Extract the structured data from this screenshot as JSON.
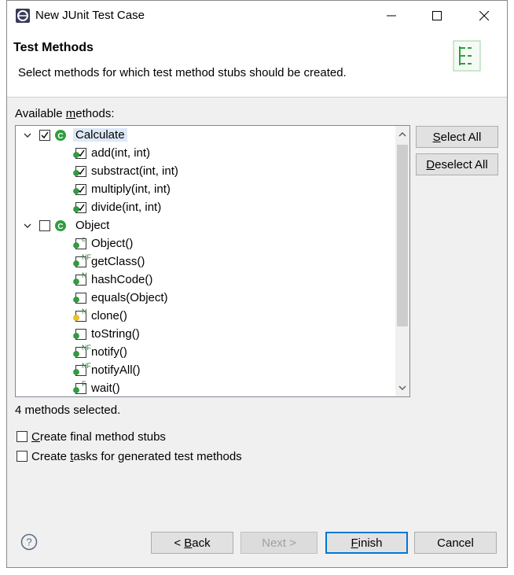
{
  "window": {
    "title": "New JUnit Test Case"
  },
  "header": {
    "title": "Test Methods",
    "description": "Select methods for which test method stubs should be created."
  },
  "methods_label": {
    "pre": "Available ",
    "key": "m",
    "post": "ethods:"
  },
  "tree": [
    {
      "label": "Calculate",
      "checked": true,
      "level": 0,
      "icon": "class-icon"
    },
    {
      "label": "add(int, int)",
      "checked": true,
      "level": 1,
      "icon": "public-method-icon",
      "badge": ""
    },
    {
      "label": "substract(int, int)",
      "checked": true,
      "level": 1,
      "icon": "public-method-icon",
      "badge": ""
    },
    {
      "label": "multiply(int, int)",
      "checked": true,
      "level": 1,
      "icon": "public-method-icon",
      "badge": ""
    },
    {
      "label": "divide(int, int)",
      "checked": true,
      "level": 1,
      "icon": "public-method-icon",
      "badge": ""
    },
    {
      "label": "Object",
      "checked": false,
      "level": 0,
      "icon": "class-icon"
    },
    {
      "label": "Object()",
      "checked": false,
      "level": 1,
      "icon": "public-method-icon",
      "badge": "c"
    },
    {
      "label": "getClass()",
      "checked": false,
      "level": 1,
      "icon": "public-method-icon",
      "badge": "NF"
    },
    {
      "label": "hashCode()",
      "checked": false,
      "level": 1,
      "icon": "public-method-icon",
      "badge": "N"
    },
    {
      "label": "equals(Object)",
      "checked": false,
      "level": 1,
      "icon": "public-method-icon",
      "badge": ""
    },
    {
      "label": "clone()",
      "checked": false,
      "level": 1,
      "icon": "protected-method-icon",
      "badge": "N"
    },
    {
      "label": "toString()",
      "checked": false,
      "level": 1,
      "icon": "public-method-icon",
      "badge": ""
    },
    {
      "label": "notify()",
      "checked": false,
      "level": 1,
      "icon": "public-method-icon",
      "badge": "NF"
    },
    {
      "label": "notifyAll()",
      "checked": false,
      "level": 1,
      "icon": "public-method-icon",
      "badge": "NF"
    },
    {
      "label": "wait()",
      "checked": false,
      "level": 1,
      "icon": "public-method-icon",
      "badge": "F"
    }
  ],
  "buttons": {
    "select_all": {
      "key": "S",
      "rest": "elect All"
    },
    "deselect_all": {
      "key": "D",
      "rest": "eselect All"
    },
    "back": {
      "pre": "< ",
      "key": "B",
      "rest": "ack"
    },
    "next": "Next >",
    "finish": {
      "key": "F",
      "rest": "inish"
    },
    "cancel": "Cancel"
  },
  "status": "4 methods selected.",
  "options": {
    "final_stubs": {
      "checked": false,
      "key": "C",
      "rest": "reate final method stubs"
    },
    "tasks": {
      "checked": false,
      "pre": "Create ",
      "key": "t",
      "rest": "asks for generated test methods"
    }
  },
  "colors": {
    "accent": "#0078d7",
    "method_green": "#2e9e3e",
    "protected_yellow": "#f0c419"
  }
}
